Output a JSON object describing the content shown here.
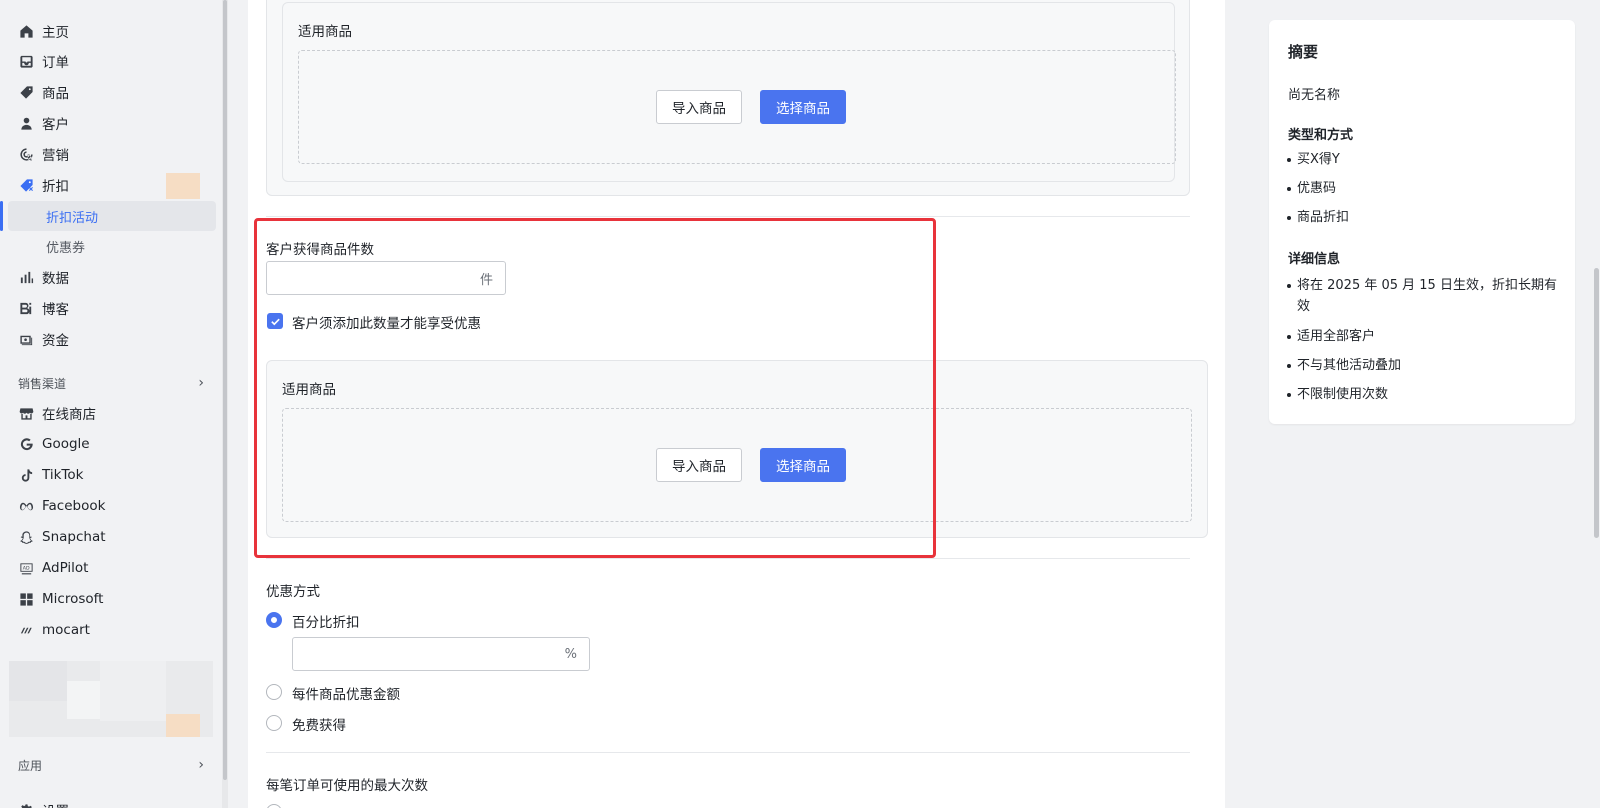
{
  "sidebar": {
    "items": [
      {
        "label": "主页",
        "icon": "home-icon"
      },
      {
        "label": "订单",
        "icon": "inbox-icon"
      },
      {
        "label": "商品",
        "icon": "tag-icon"
      },
      {
        "label": "客户",
        "icon": "person-icon"
      },
      {
        "label": "营销",
        "icon": "target-icon"
      },
      {
        "label": "折扣",
        "icon": "discount-icon"
      }
    ],
    "discount_sub": [
      {
        "label": "折扣活动",
        "active": true
      },
      {
        "label": "优惠券",
        "active": false
      }
    ],
    "items2": [
      {
        "label": "数据",
        "icon": "bar-chart-icon"
      },
      {
        "label": "博客",
        "icon": "blog-icon"
      },
      {
        "label": "资金",
        "icon": "wallet-icon"
      }
    ],
    "sales_channels_label": "销售渠道",
    "channels": [
      {
        "label": "在线商店",
        "icon": "store-icon"
      },
      {
        "label": "Google",
        "icon": "google-icon"
      },
      {
        "label": "TikTok",
        "icon": "tiktok-icon"
      },
      {
        "label": "Facebook",
        "icon": "meta-icon"
      },
      {
        "label": "Snapchat",
        "icon": "snapchat-icon"
      },
      {
        "label": "AdPilot",
        "icon": "adpilot-icon"
      },
      {
        "label": "Microsoft",
        "icon": "microsoft-icon"
      },
      {
        "label": "mocart",
        "icon": "mocart-icon"
      }
    ],
    "apps_label": "应用",
    "settings_label": "设置",
    "accent_color": "#3a6ef3"
  },
  "main": {
    "top_card": {
      "title": "适用商品",
      "import_label": "导入商品",
      "select_label": "选择商品"
    },
    "qty": {
      "label": "客户获得商品件数",
      "value": "",
      "suffix": "件",
      "checkbox_label": "客户须添加此数量才能享受优惠",
      "checked": true
    },
    "inner_card": {
      "title": "适用商品",
      "import_label": "导入商品",
      "select_label": "选择商品"
    },
    "discount_method": {
      "label": "优惠方式",
      "options": [
        {
          "label": "百分比折扣",
          "selected": true
        },
        {
          "label": "每件商品优惠金额",
          "selected": false
        },
        {
          "label": "免费获得",
          "selected": false
        }
      ],
      "percent_value": "",
      "percent_suffix": "%"
    },
    "max_uses": {
      "label": "每笔订单可使用的最大次数"
    },
    "highlight_color": "#e8333b",
    "primary_color": "#4a74ef"
  },
  "summary": {
    "title": "摘要",
    "name": "尚无名称",
    "type_heading": "类型和方式",
    "type_items": [
      "买X得Y",
      "优惠码",
      "商品折扣"
    ],
    "detail_heading": "详细信息",
    "detail_items": [
      "将在 2025 年 05 月 15 日生效，折扣长期有效",
      "适用全部客户",
      "不与其他活动叠加",
      "不限制使用次数"
    ]
  }
}
